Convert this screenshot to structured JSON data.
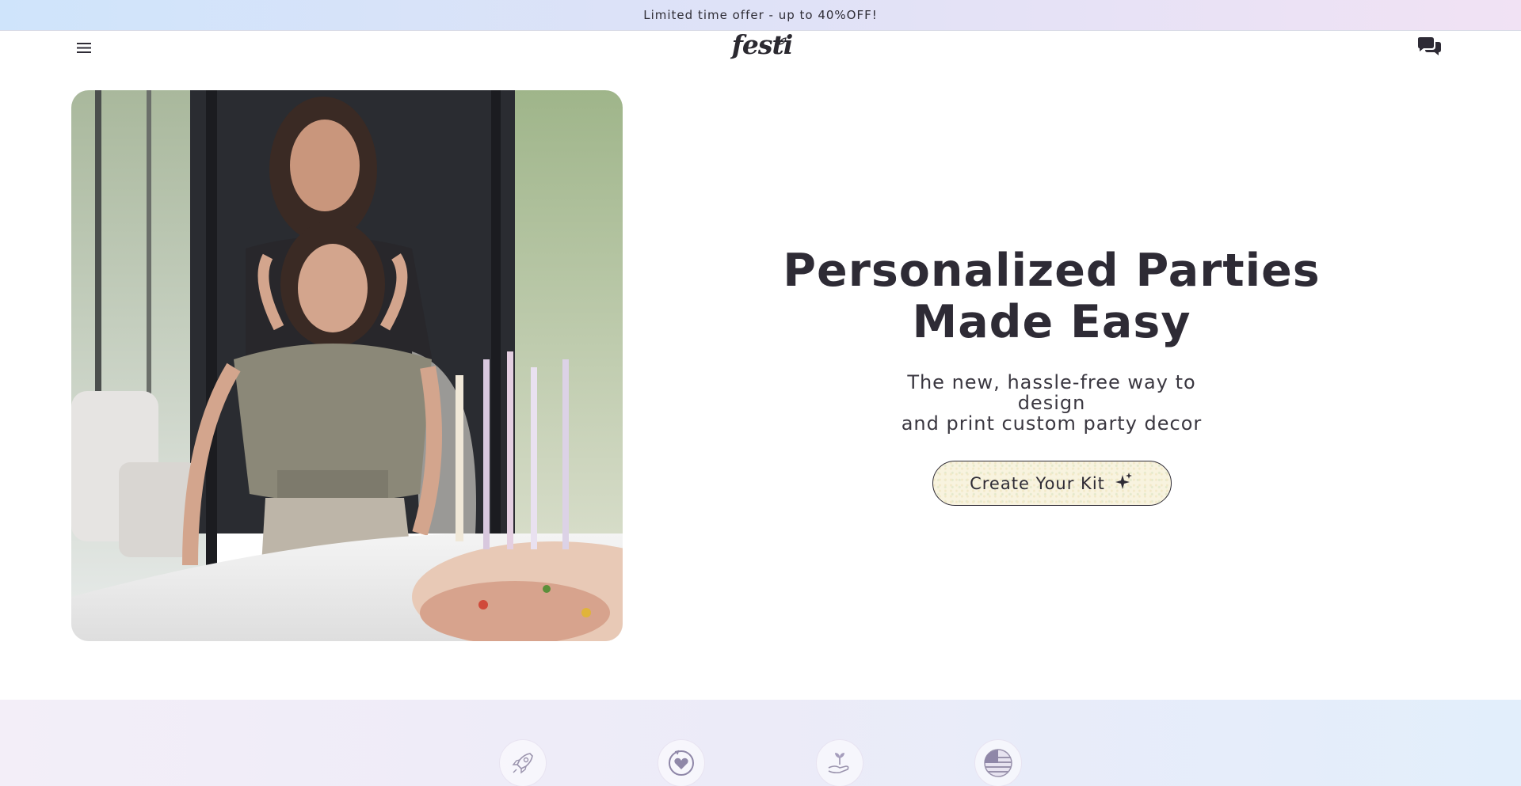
{
  "announcement": {
    "text": "Limited time offer - up to 40%OFF!"
  },
  "header": {
    "logo_text": "festi",
    "menu_icon": "hamburger-menu-icon",
    "chat_icon": "chat-bubbles-icon"
  },
  "hero": {
    "image_alt": "mother-and-daughter-birthday-photo",
    "title_line1": "Personalized Parties",
    "title_line2": "Made Easy",
    "subtitle_line1": "The new, hassle-free way to design",
    "subtitle_line2": "and print custom party decor",
    "cta_label": "Create Your Kit",
    "cta_icon": "sparkle-icon"
  },
  "features": {
    "icons": [
      "rocket-icon",
      "heart-refresh-icon",
      "hand-plant-icon",
      "us-flag-icon"
    ]
  },
  "colors": {
    "text_dark": "#2e2b35",
    "cta_fill": "#f8f3df",
    "banner_left": "#cfe4fb",
    "banner_right": "#f1e2f4"
  }
}
